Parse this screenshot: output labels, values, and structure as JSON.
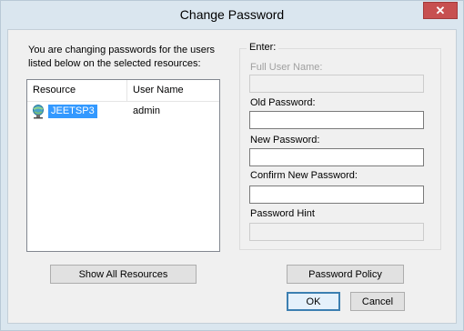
{
  "window": {
    "title": "Change Password",
    "close_glyph": "✕"
  },
  "intro_text": "You are changing passwords for the users listed below on the selected resources:",
  "resources_table": {
    "columns": [
      "Resource",
      "User Name"
    ],
    "rows": [
      {
        "resource": "JEETSP3",
        "user": "admin",
        "icon": "server-icon",
        "selected": true
      }
    ]
  },
  "enter_group": {
    "legend": "Enter:",
    "full_user_name_label": "Full User Name:",
    "full_user_name_value": "",
    "old_password_label": "Old Password:",
    "old_password_value": "",
    "new_password_label": "New Password:",
    "new_password_value": "",
    "confirm_password_label": "Confirm New Password:",
    "confirm_password_value": "",
    "password_hint_label": "Password Hint",
    "password_hint_value": ""
  },
  "buttons": {
    "show_all_resources": "Show All Resources",
    "password_policy": "Password Policy",
    "ok": "OK",
    "cancel": "Cancel"
  },
  "colors": {
    "selection": "#3399ff",
    "close_button": "#c75050",
    "frame": "#dae6ef"
  }
}
